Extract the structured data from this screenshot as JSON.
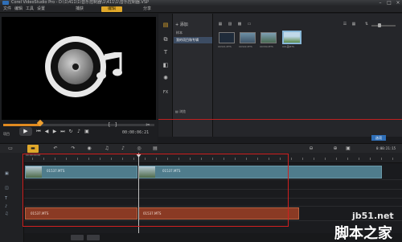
{
  "window": {
    "title": "Corel VideoStudio Pro - D:\\1\\411\\1\\音乐控制器\\1\\411\\1\\音乐控制器.VSP",
    "controls": [
      "–",
      "□",
      "×"
    ]
  },
  "menu": {
    "items": [
      "文件",
      "编辑",
      "工具",
      "设置"
    ]
  },
  "steps": {
    "tabs": [
      "捕获",
      "编辑",
      "分享"
    ]
  },
  "preview": {
    "mode_label": "项目",
    "timecode": "00:00:06:21",
    "controls": [
      "prev-icon",
      "play-icon",
      "rewind-icon",
      "step-back-icon",
      "step-forward-icon",
      "end-icon",
      "repeat-icon",
      "volume-icon",
      "hd-icon"
    ],
    "position_fraction": 0.24
  },
  "library": {
    "add_label": "添加",
    "folders": [
      "样本",
      "我的项目和专辑"
    ],
    "browse_label": "浏览",
    "thumbnails": [
      {
        "label": "00321.MTS"
      },
      {
        "label": "00322.MTS"
      },
      {
        "label": "00330.MTS"
      },
      {
        "label": "001美MTS"
      }
    ],
    "options_label": "选项",
    "icons": [
      "media-icon",
      "transition-icon",
      "title-icon",
      "graphic-icon",
      "filter-icon",
      "fx-icon"
    ]
  },
  "timeline": {
    "time_display": "0:00:21:15",
    "ruler_start": "00:00:00:00",
    "tracks": [
      "video-track-icon",
      "overlay-track-icon",
      "title-track-icon",
      "voice-track-icon",
      "music-track-icon"
    ],
    "video_clips": [
      {
        "label": "01537.MTS"
      },
      {
        "label": "01537.MTS"
      }
    ],
    "audio_clips": [
      {
        "label": "01537.MTS"
      },
      {
        "label": "01537.MTS"
      }
    ]
  },
  "watermark": {
    "line1": "jb51.net",
    "line2": "脚本之家"
  },
  "colors": {
    "accent": "#e0a82a",
    "highlight": "#d02020",
    "video_clip": "#4f7c8c",
    "audio_clip": "#8a3a24"
  }
}
